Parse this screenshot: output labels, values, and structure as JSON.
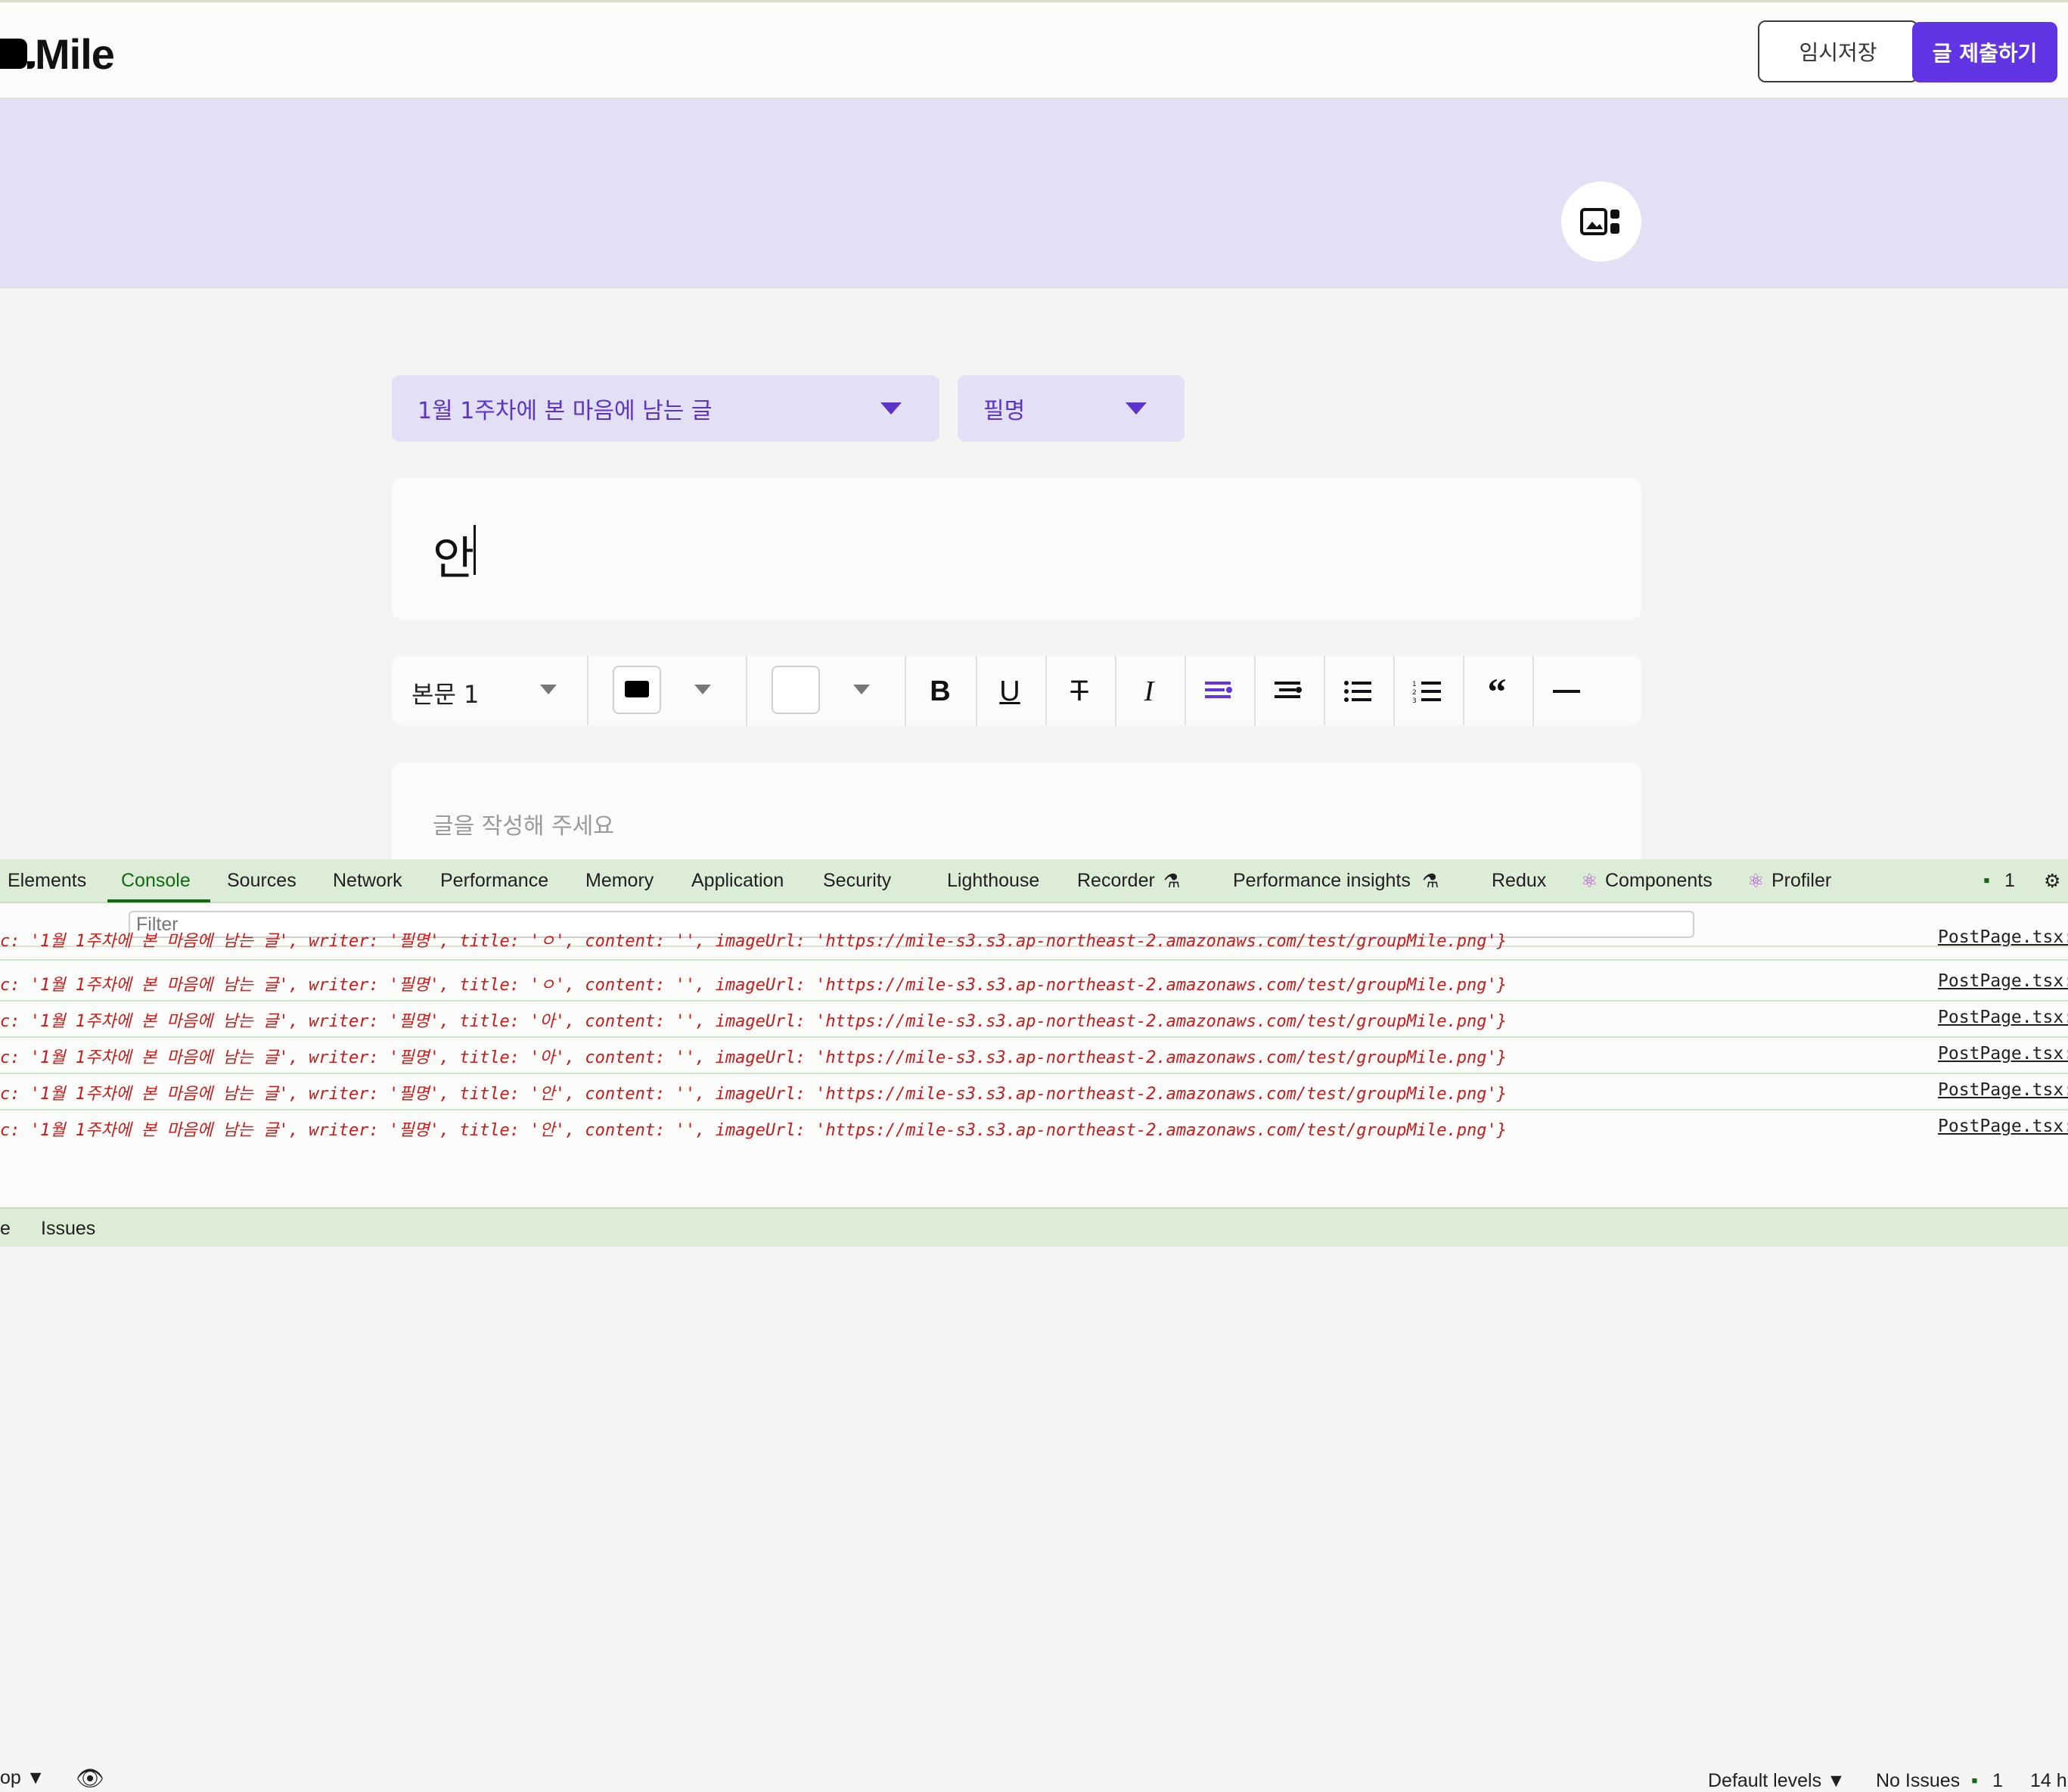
{
  "header": {
    "logo_text": "Mile",
    "save_label": "임시저장",
    "submit_label": "글 제출하기"
  },
  "editor": {
    "topic_select": "1월 1주차에 본 마음에 남는 글",
    "writer_select": "필명",
    "title_value": "안",
    "toolbar": {
      "font_style": "본문 1",
      "tools": [
        "B",
        "U",
        "T",
        "I",
        "align-left",
        "align-center",
        "bulleted-list",
        "numbered-list",
        "quote",
        "divider"
      ]
    },
    "body_placeholder": "글을 작성해 주세요"
  },
  "devtools": {
    "tabs": [
      "Elements",
      "Console",
      "Sources",
      "Network",
      "Performance",
      "Memory",
      "Application",
      "Security",
      "Lighthouse",
      "Recorder",
      "Performance insights",
      "Redux",
      "Components",
      "Profiler"
    ],
    "active_tab": "Console",
    "message_count": "1",
    "context": "op",
    "filter_placeholder": "Filter",
    "levels": "Default levels",
    "issues_label": "No Issues",
    "issues_count": "1",
    "hidden": "14 h",
    "logs": [
      "c: '1월 1주차에 본 마음에 남는 글', writer: '필명', title: 'ㅇ', content: '', imageUrl: 'https://mile-s3.s3.ap-northeast-2.amazonaws.com/test/groupMile.png'}",
      "c: '1월 1주차에 본 마음에 남는 글', writer: '필명', title: 'ㅇ', content: '', imageUrl: 'https://mile-s3.s3.ap-northeast-2.amazonaws.com/test/groupMile.png'}",
      "c: '1월 1주차에 본 마음에 남는 글', writer: '필명', title: '아', content: '', imageUrl: 'https://mile-s3.s3.ap-northeast-2.amazonaws.com/test/groupMile.png'}",
      "c: '1월 1주차에 본 마음에 남는 글', writer: '필명', title: '아', content: '', imageUrl: 'https://mile-s3.s3.ap-northeast-2.amazonaws.com/test/groupMile.png'}",
      "c: '1월 1주차에 본 마음에 남는 글', writer: '필명', title: '안', content: '', imageUrl: 'https://mile-s3.s3.ap-northeast-2.amazonaws.com/test/groupMile.png'}",
      "c: '1월 1주차에 본 마음에 남는 글', writer: '필명', title: '안', content: '', imageUrl: 'https://mile-s3.s3.ap-northeast-2.amazonaws.com/test/groupMile.png'}"
    ],
    "log_source": "PostPage.tsx:",
    "drawer_left": "e",
    "drawer_tab": "Issues"
  }
}
